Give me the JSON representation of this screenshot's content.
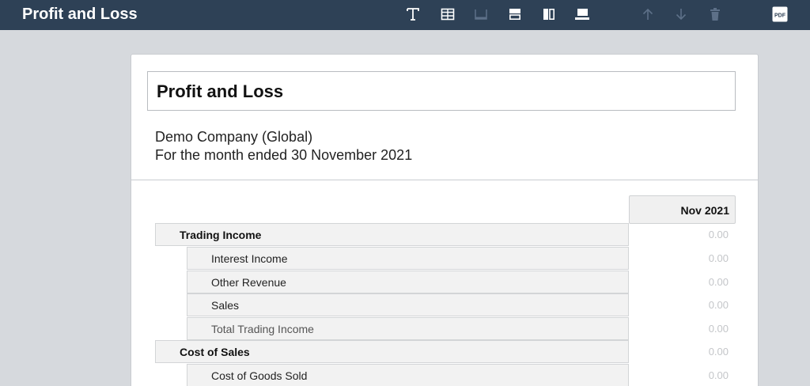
{
  "header": {
    "title": "Profit and Loss",
    "toolbar": [
      {
        "name": "text-icon",
        "enabled": true
      },
      {
        "name": "table-icon",
        "enabled": true
      },
      {
        "name": "footer-row-icon",
        "enabled": false
      },
      {
        "name": "split-row-icon",
        "enabled": true
      },
      {
        "name": "split-column-icon",
        "enabled": true
      },
      {
        "name": "insert-row-icon",
        "enabled": true
      },
      {
        "name": "arrow-up-icon",
        "enabled": false
      },
      {
        "name": "arrow-down-icon",
        "enabled": false
      },
      {
        "name": "trash-icon",
        "enabled": false
      },
      {
        "name": "pdf-icon",
        "enabled": true,
        "label": "PDF"
      }
    ]
  },
  "report": {
    "title": "Profit and Loss",
    "organisation": "Demo Company (Global)",
    "period": "For the month ended 30 November 2021",
    "column_header": "Nov 2021",
    "rows": [
      {
        "label": "Trading Income",
        "type": "section",
        "value": "0.00"
      },
      {
        "label": "Interest Income",
        "type": "item",
        "value": "0.00"
      },
      {
        "label": "Other Revenue",
        "type": "item",
        "value": "0.00"
      },
      {
        "label": "Sales",
        "type": "item",
        "value": "0.00"
      },
      {
        "label": "Total Trading Income",
        "type": "total",
        "value": "0.00"
      },
      {
        "label": "Cost of Sales",
        "type": "section",
        "value": "0.00"
      },
      {
        "label": "Cost of Goods Sold",
        "type": "item",
        "value": "0.00"
      }
    ]
  },
  "colors": {
    "header_bg": "#2e4156",
    "page_bg": "#d6d9dd",
    "row_bg": "#f2f2f2",
    "value_text": "#c4c6c9"
  }
}
